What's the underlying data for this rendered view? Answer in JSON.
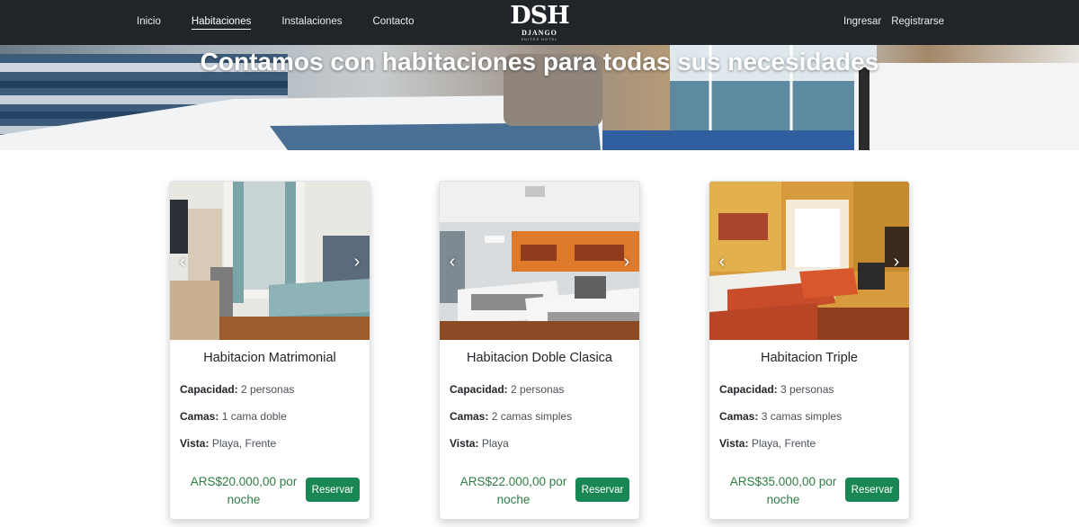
{
  "nav": {
    "links": [
      "Inicio",
      "Habitaciones",
      "Instalaciones",
      "Contacto"
    ],
    "active": "Habitaciones",
    "right_links": [
      "Ingresar",
      "Registrarse"
    ]
  },
  "logo": {
    "mark": "DSH",
    "sub": "DJANGO",
    "tiny": "SUITES HOTEL"
  },
  "hero": {
    "title": "Contamos con habitaciones para todas sus necesidades"
  },
  "labels": {
    "capacity": "Capacidad:",
    "beds": "Camas:",
    "view": "Vista:",
    "reserve": "Reservar"
  },
  "rooms": [
    {
      "title": "Habitacion Matrimonial",
      "capacity": "2 personas",
      "beds": "1 cama doble",
      "view": "Playa, Frente",
      "price": "ARS$20.000,00 por noche"
    },
    {
      "title": "Habitacion Doble Clasica",
      "capacity": "2 personas",
      "beds": "2 camas simples",
      "view": "Playa",
      "price": "ARS$22.000,00 por noche"
    },
    {
      "title": "Habitacion Triple",
      "capacity": "3 personas",
      "beds": "3 camas simples",
      "view": "Playa, Frente",
      "price": "ARS$35.000,00 por noche"
    }
  ],
  "icons": {
    "prev": "chevron-left-icon",
    "next": "chevron-right-icon"
  },
  "colors": {
    "navbar": "#212529",
    "accent_green": "#198754",
    "price_green": "#2f7d44"
  }
}
